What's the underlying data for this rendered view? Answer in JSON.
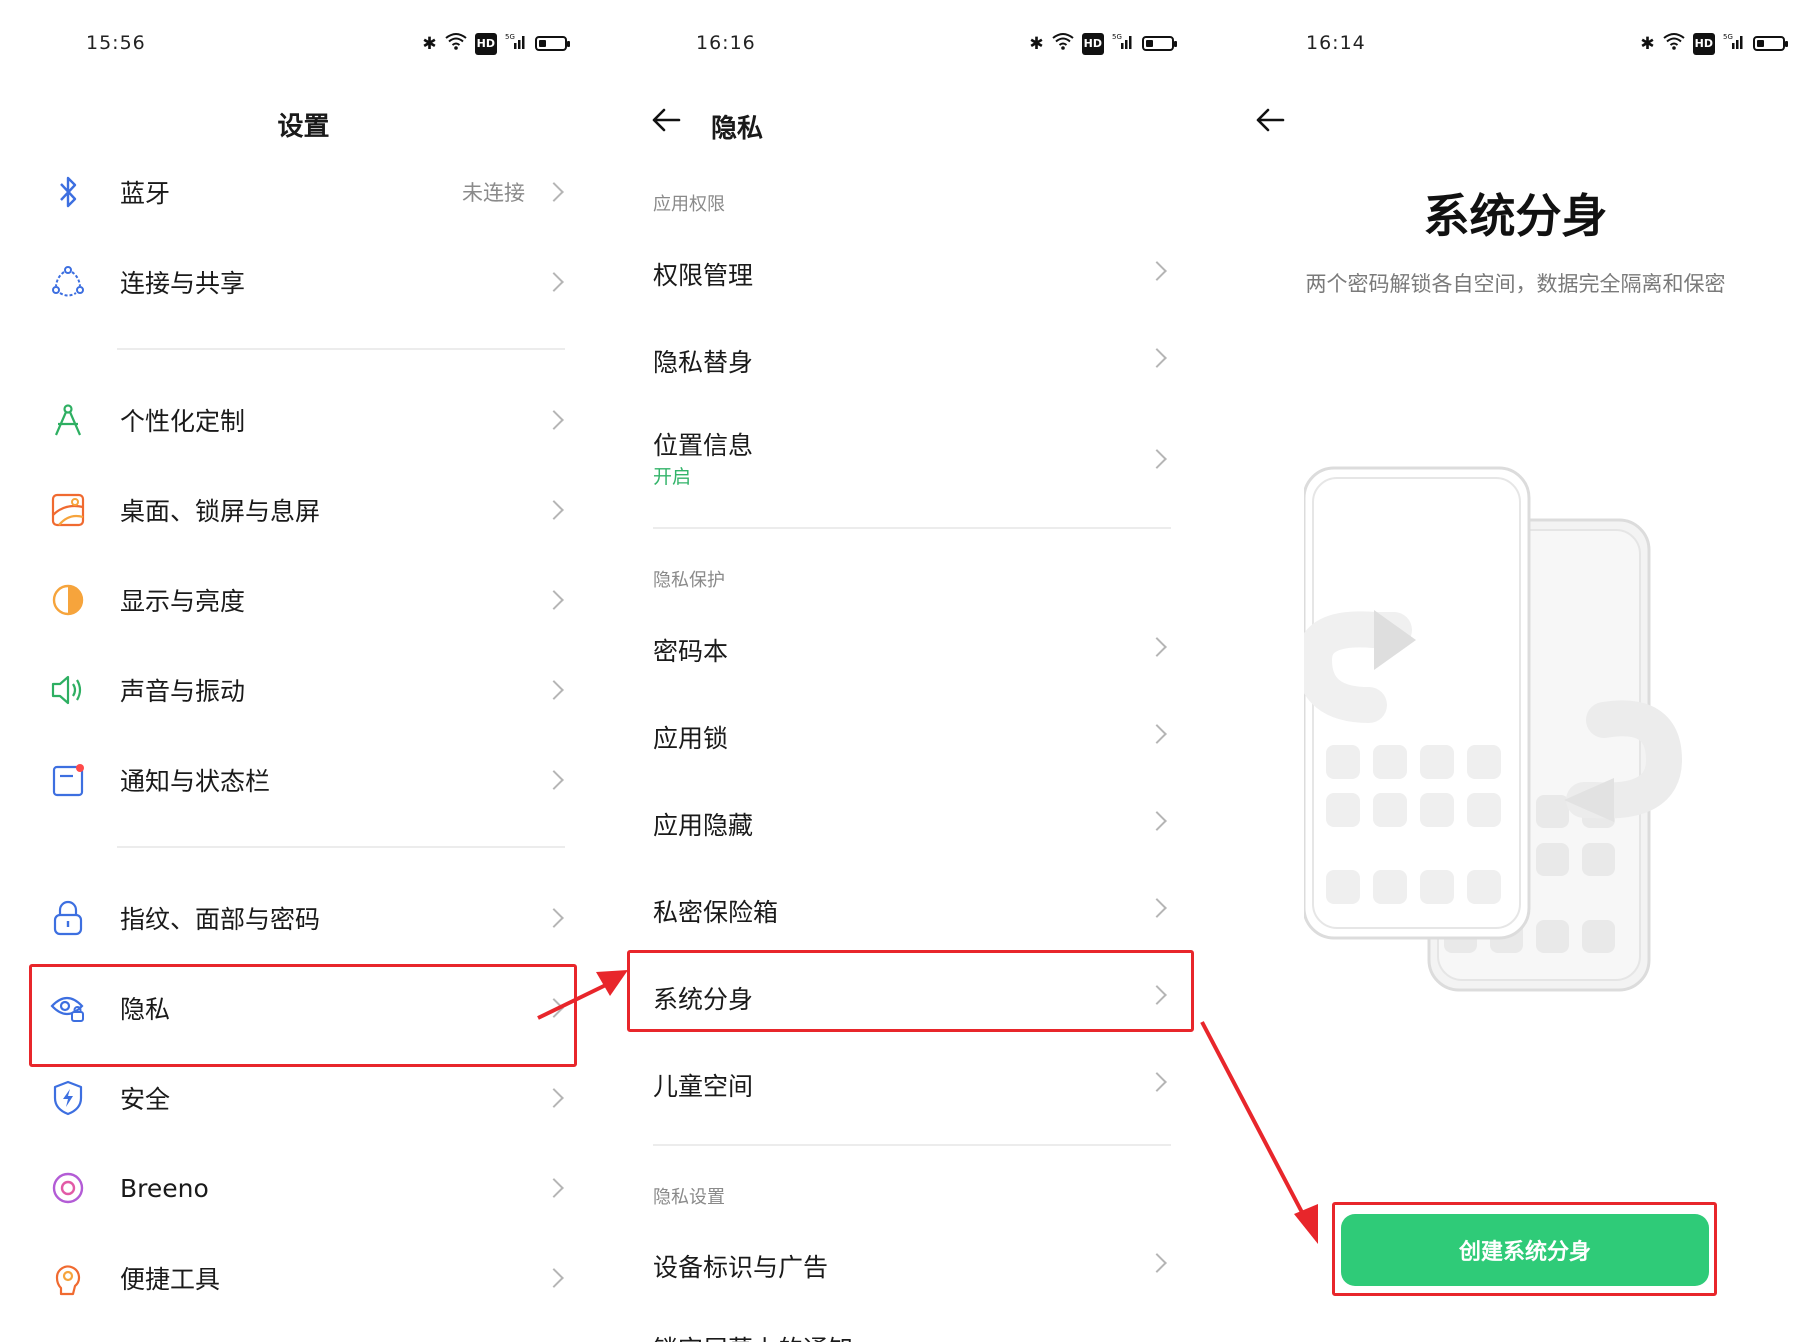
{
  "screen1": {
    "time": "15:56",
    "title": "设置",
    "items": [
      {
        "label": "蓝牙",
        "value": "未连接",
        "icon": "bluetooth-icon"
      },
      {
        "label": "连接与共享",
        "icon": "share-connect-icon"
      },
      {
        "label": "个性化定制",
        "icon": "compass-icon"
      },
      {
        "label": "桌面、锁屏与息屏",
        "icon": "wallpaper-icon"
      },
      {
        "label": "显示与亮度",
        "icon": "brightness-icon"
      },
      {
        "label": "声音与振动",
        "icon": "speaker-icon"
      },
      {
        "label": "通知与状态栏",
        "icon": "notification-icon"
      },
      {
        "label": "指纹、面部与密码",
        "icon": "lock-icon"
      },
      {
        "label": "隐私",
        "icon": "privacy-eye-icon"
      },
      {
        "label": "安全",
        "icon": "shield-icon"
      },
      {
        "label": "Breeno",
        "icon": "breeno-icon"
      },
      {
        "label": "便捷工具",
        "icon": "tools-icon"
      }
    ]
  },
  "screen2": {
    "time": "16:16",
    "title": "隐私",
    "sections": [
      {
        "header": "应用权限",
        "items": [
          "权限管理",
          "隐私替身",
          "位置信息"
        ],
        "location_status": "开启"
      },
      {
        "header": "隐私保护",
        "items": [
          "密码本",
          "应用锁",
          "应用隐藏",
          "私密保险箱",
          "系统分身",
          "儿童空间"
        ]
      },
      {
        "header": "隐私设置",
        "items": [
          "设备标识与广告",
          "锁定屏幕上的通知"
        ]
      }
    ]
  },
  "screen3": {
    "time": "16:14",
    "title": "系统分身",
    "subtitle": "两个密码解锁各自空间，数据完全隔离和保密",
    "button": "创建系统分身"
  },
  "colors": {
    "accent_green": "#2fcb78",
    "highlight_red": "#e8262b",
    "status_green": "#33b46a"
  }
}
